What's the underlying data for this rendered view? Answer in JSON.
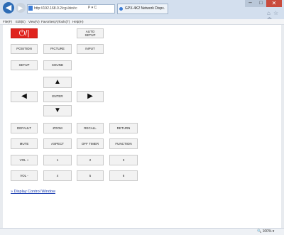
{
  "browser": {
    "address": "http://192.168.0.2/cgi-bin/rc",
    "address_controls": "P ▾ C",
    "tab_title": "GPX-4K2 Network Disp...",
    "tab_close": "×",
    "window_controls": {
      "minimize": "–",
      "maximize": "□",
      "close": "✕"
    },
    "toolbar_icons": "⌂ ☆ ⚙",
    "menu": [
      "File(F)",
      "Edit(E)",
      "View(V)",
      "Favorites(A)",
      "Tools(T)",
      "Help(H)"
    ],
    "zoom": "🔍 100%  ▾"
  },
  "remote": {
    "power": "⏻/|",
    "auto_setup": "AUTO\nSETUP",
    "position": "POSITION",
    "picture": "PICTURE",
    "input": "INPUT",
    "setup": "SETUP",
    "sound": "SOUND",
    "up": "▲",
    "left": "◀",
    "enter": "ENTER",
    "right": "▶",
    "down": "▼",
    "row1": [
      "DEFAULT",
      "ZOOM",
      "RECALL",
      "RETURN"
    ],
    "row2": [
      "MUTE",
      "ASPECT",
      "OFF TIMER",
      "FUNCTION"
    ],
    "row3": [
      "VOL +",
      "1",
      "2",
      "3"
    ],
    "row4": [
      "VOL -",
      "4",
      "5",
      "6"
    ]
  },
  "links": {
    "display_control": "» Display Control Window"
  }
}
